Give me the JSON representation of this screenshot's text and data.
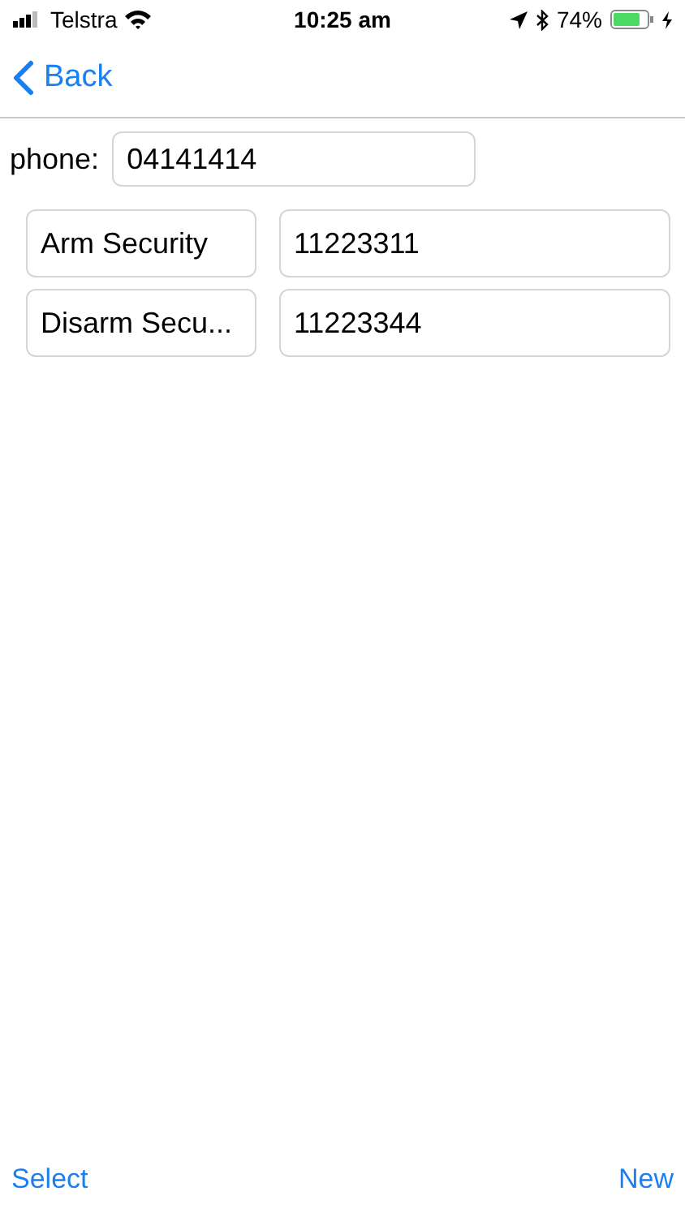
{
  "status_bar": {
    "carrier": "Telstra",
    "time": "10:25 am",
    "battery": "74%"
  },
  "nav": {
    "back": "Back"
  },
  "phone": {
    "label": "phone:",
    "value": "04141414"
  },
  "commands": [
    {
      "name": "Arm Security",
      "code": "11223311"
    },
    {
      "name": "Disarm Secu...",
      "code": "11223344"
    }
  ],
  "toolbar": {
    "left": "Select",
    "right": "New"
  }
}
